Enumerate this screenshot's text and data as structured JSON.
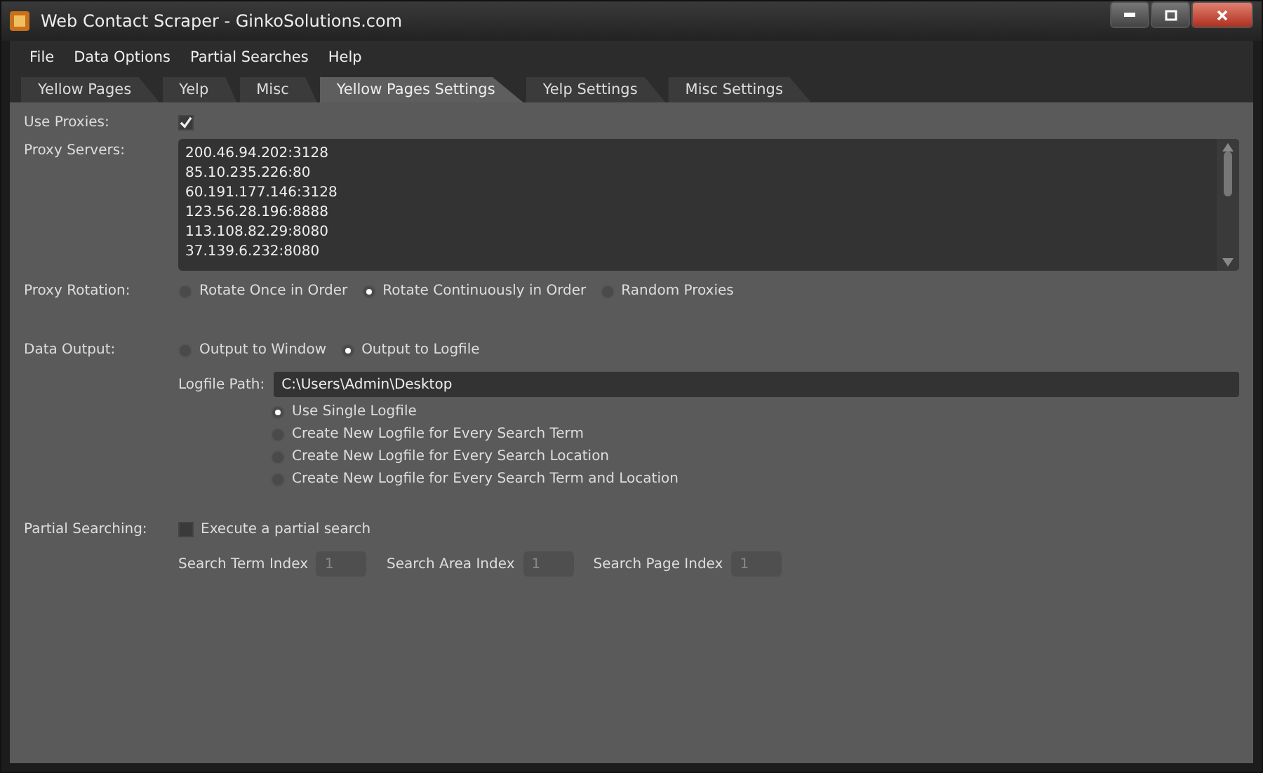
{
  "window": {
    "title": "Web Contact Scraper - GinkoSolutions.com"
  },
  "menu": [
    "File",
    "Data Options",
    "Partial Searches",
    "Help"
  ],
  "tabs": [
    {
      "label": "Yellow Pages",
      "selected": false
    },
    {
      "label": "Yelp",
      "selected": false
    },
    {
      "label": "Misc",
      "selected": false
    },
    {
      "label": "Yellow Pages Settings",
      "selected": true
    },
    {
      "label": "Yelp Settings",
      "selected": false
    },
    {
      "label": "Misc Settings",
      "selected": false
    }
  ],
  "use_proxies": {
    "label": "Use Proxies:",
    "checked": true
  },
  "proxy_servers": {
    "label": "Proxy Servers:",
    "lines": [
      "200.46.94.202:3128",
      "85.10.235.226:80",
      "60.191.177.146:3128",
      "123.56.28.196:8888",
      "113.108.82.29:8080",
      "37.139.6.232:8080"
    ]
  },
  "proxy_rotation": {
    "label": "Proxy Rotation:",
    "options": [
      {
        "label": "Rotate Once in Order",
        "selected": false
      },
      {
        "label": "Rotate Continuously in Order",
        "selected": true
      },
      {
        "label": "Random Proxies",
        "selected": false
      }
    ]
  },
  "data_output": {
    "label": "Data Output:",
    "options": [
      {
        "label": "Output to Window",
        "selected": false
      },
      {
        "label": "Output to Logfile",
        "selected": true
      }
    ],
    "logfile_path": {
      "label": "Logfile Path:",
      "value": "C:\\Users\\Admin\\Desktop"
    },
    "logfile_options": [
      {
        "label": "Use Single Logfile",
        "selected": true
      },
      {
        "label": "Create New Logfile for Every Search Term",
        "selected": false
      },
      {
        "label": "Create New Logfile for Every Search Location",
        "selected": false
      },
      {
        "label": "Create New Logfile for Every Search Term and Location",
        "selected": false
      }
    ]
  },
  "partial_searching": {
    "label": "Partial Searching:",
    "checkbox": {
      "label": "Execute a partial search",
      "checked": false
    },
    "fields": [
      {
        "label": "Search Term Index",
        "value": "1",
        "disabled": true
      },
      {
        "label": "Search Area Index",
        "value": "1",
        "disabled": true
      },
      {
        "label": "Search Page Index",
        "value": "1",
        "disabled": true
      }
    ]
  }
}
